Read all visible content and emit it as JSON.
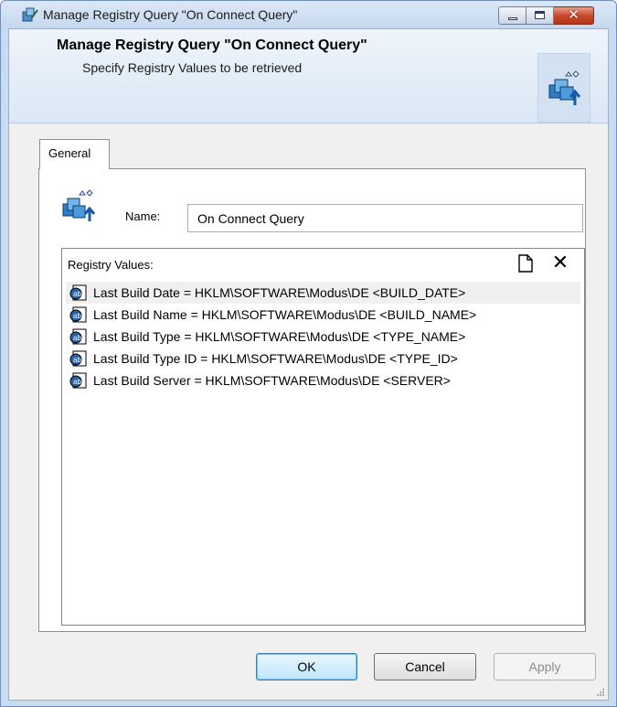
{
  "window": {
    "title": "Manage Registry Query \"On Connect Query\"",
    "close_glyph": "✕"
  },
  "header": {
    "title": "Manage Registry Query \"On Connect Query\"",
    "subtitle": "Specify Registry Values to be retrieved"
  },
  "tabs": [
    {
      "label": "General",
      "active": true
    }
  ],
  "form": {
    "name_label": "Name:",
    "name_value": "On Connect Query"
  },
  "registry_values": {
    "label": "Registry Values:",
    "delete_glyph": "✕",
    "items": [
      "Last Build Date = HKLM\\SOFTWARE\\Modus\\DE <BUILD_DATE>",
      "Last Build Name = HKLM\\SOFTWARE\\Modus\\DE <BUILD_NAME>",
      "Last Build Type = HKLM\\SOFTWARE\\Modus\\DE <TYPE_NAME>",
      "Last Build Type ID = HKLM\\SOFTWARE\\Modus\\DE <TYPE_ID>",
      "Last Build Server = HKLM\\SOFTWARE\\Modus\\DE <SERVER>"
    ]
  },
  "buttons": {
    "ok": "OK",
    "cancel": "Cancel",
    "apply": "Apply"
  },
  "colors": {
    "window_frame": "#c9dbf0",
    "close_button": "#c94a2e",
    "ok_border": "#3c7fb1"
  }
}
